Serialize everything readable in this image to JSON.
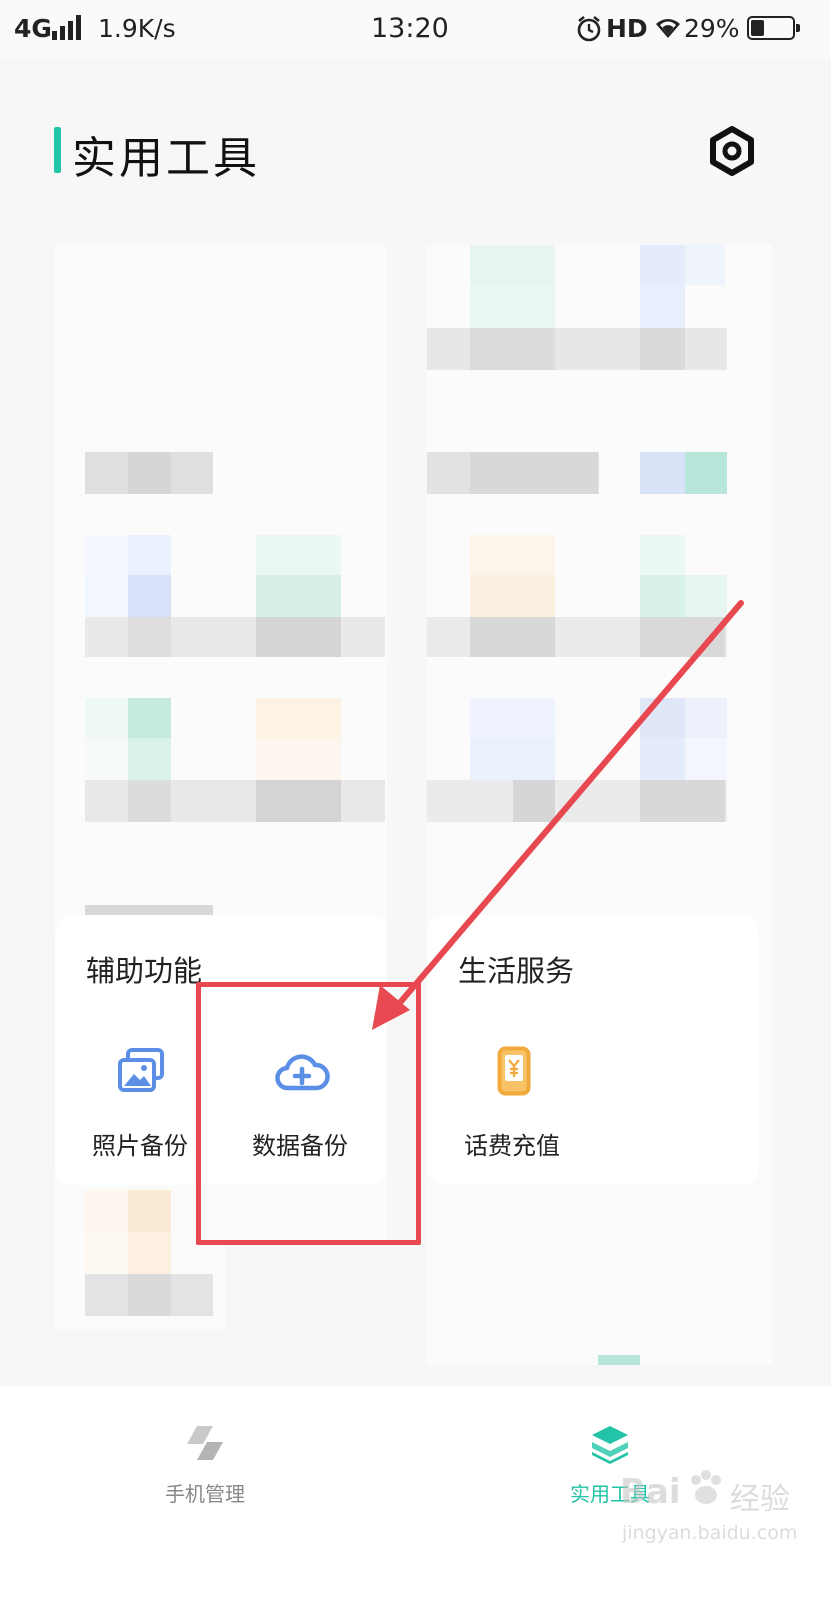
{
  "status_bar": {
    "network": "4G",
    "speed": "1.9K/s",
    "time": "13:20",
    "hd": "HD",
    "battery": "29%",
    "battery_level": 0.29,
    "icons": [
      "signal-bars-icon",
      "alarm-icon",
      "wifi-icon",
      "battery-icon"
    ]
  },
  "header": {
    "title": "实用工具",
    "settings_icon": "settings-hexagon-icon",
    "accent_color": "#22c3a6"
  },
  "assist_section": {
    "title": "辅助功能",
    "items": [
      {
        "label": "照片备份",
        "icon": "photo-backup-icon"
      },
      {
        "label": "数据备份",
        "icon": "cloud-upload-icon"
      }
    ]
  },
  "life_section": {
    "title": "生活服务",
    "items": [
      {
        "label": "话费充值",
        "icon": "phone-recharge-icon"
      }
    ]
  },
  "bottom_nav": {
    "items": [
      {
        "label": "手机管理",
        "icon": "phone-manage-icon",
        "active": false
      },
      {
        "label": "实用工具",
        "icon": "layers-icon",
        "active": true
      }
    ],
    "active_color": "#22c3a6"
  },
  "annotation": {
    "color": "#e84850"
  },
  "watermark": {
    "brand": "Bai",
    "brand_cn": "经验",
    "url": "jingyan.baidu.com"
  }
}
